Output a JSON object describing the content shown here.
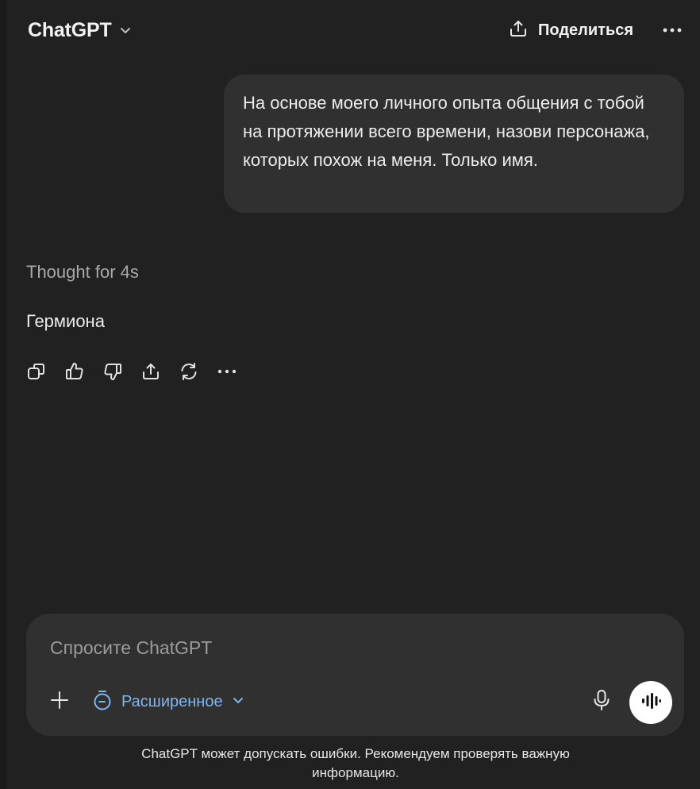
{
  "header": {
    "model_title": "ChatGPT",
    "share_label": "Поделиться"
  },
  "conversation": {
    "user_message": "На основе моего личного опыта общения с тобой на протяжении всего времени, назови персонажа, которых похож на меня. Только имя.",
    "thought_label": "Thought for 4s",
    "assistant_answer": "Гермиона",
    "actions": [
      "copy-icon",
      "thumbs-up-icon",
      "thumbs-down-icon",
      "share-icon",
      "regenerate-icon",
      "more-icon"
    ]
  },
  "composer": {
    "placeholder": "Спросите ChatGPT",
    "mode_label": "Расширенное",
    "icons": [
      "plus-icon",
      "timer-icon",
      "chevron-down-icon",
      "microphone-icon",
      "voice-waveform-icon"
    ]
  },
  "footer": {
    "disclaimer": "ChatGPT может допускать ошибки. Рекомендуем проверять важную информацию."
  },
  "colors": {
    "background": "#212121",
    "bubble": "#303030",
    "accent_blue": "#7db6f0",
    "text": "#ececec",
    "muted": "#a8a8a8"
  }
}
